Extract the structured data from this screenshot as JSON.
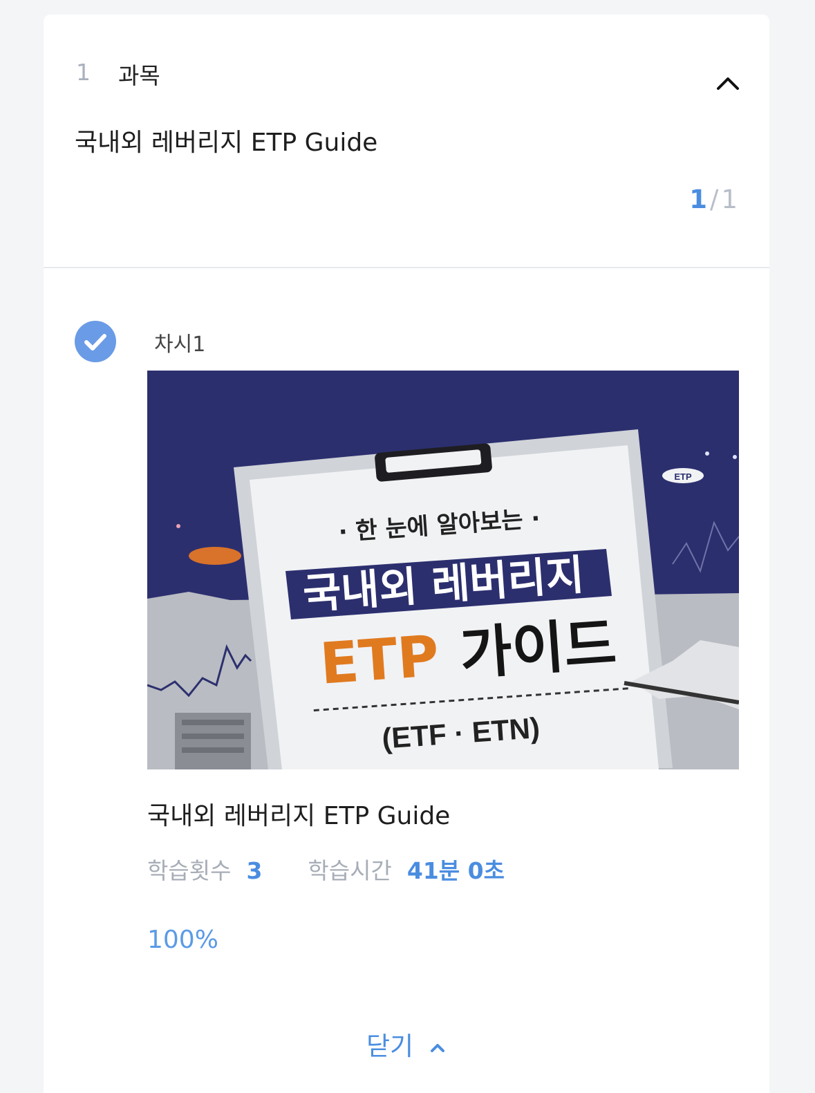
{
  "course": {
    "number": "1",
    "category": "과목",
    "title": "국내외 레버리지 ETP Guide",
    "page_current": "1",
    "page_separator": "/",
    "page_total": "1"
  },
  "session": {
    "label": "차시1",
    "completed": true,
    "thumbnail": {
      "subtitle": "· 한 눈에 알아보는 ·",
      "title_line1": "국내외 레버리지",
      "title_line2a": "ETP",
      "title_line2b": "가이드",
      "title_line3": "(ETF · ETN)",
      "badge": "ETP"
    },
    "lesson_title": "국내외 레버리지 ETP Guide",
    "study_count_label": "학습횟수",
    "study_count_value": "3",
    "study_time_label": "학습시간",
    "study_time_value": "41분 0초",
    "progress": "100%"
  },
  "close_label": "닫기",
  "colors": {
    "accent": "#4a8de0",
    "check": "#6a9be6",
    "thumb_bg": "#2c2f6e",
    "thumb_orange": "#e07a1f"
  },
  "icons": {
    "collapse": "chevron-up-icon",
    "completed": "check-circle-icon",
    "close": "chevron-up-icon"
  }
}
